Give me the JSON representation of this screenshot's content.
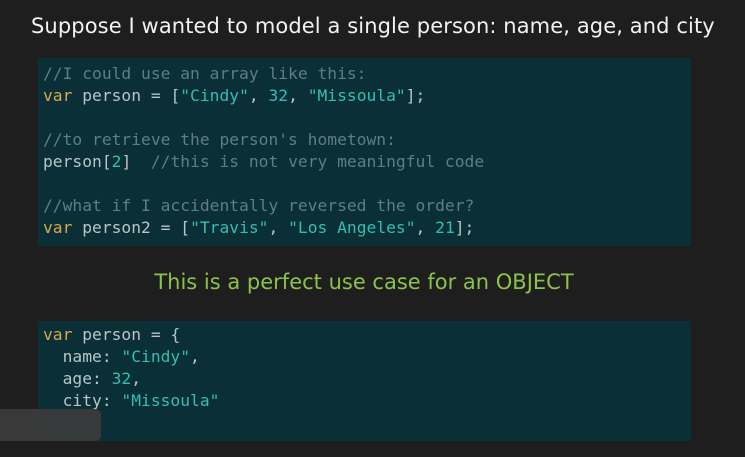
{
  "slide": {
    "title": "Suppose I wanted to model a single person: name, age, and city",
    "headline": "This is a perfect use case for an OBJECT"
  },
  "code_block_1": {
    "lines": [
      {
        "tokens": [
          {
            "type": "comment",
            "text": "//I could use an array like this:"
          }
        ]
      },
      {
        "tokens": [
          {
            "type": "keyword",
            "text": "var"
          },
          {
            "type": "plain",
            "text": " person = ["
          },
          {
            "type": "string",
            "text": "\"Cindy\""
          },
          {
            "type": "plain",
            "text": ", "
          },
          {
            "type": "number",
            "text": "32"
          },
          {
            "type": "plain",
            "text": ", "
          },
          {
            "type": "string",
            "text": "\"Missoula\""
          },
          {
            "type": "plain",
            "text": "];"
          }
        ]
      },
      {
        "tokens": []
      },
      {
        "tokens": [
          {
            "type": "comment",
            "text": "//to retrieve the person's hometown:"
          }
        ]
      },
      {
        "tokens": [
          {
            "type": "plain",
            "text": "person["
          },
          {
            "type": "number",
            "text": "2"
          },
          {
            "type": "plain",
            "text": "]  "
          },
          {
            "type": "comment",
            "text": "//this is not very meaningful code"
          }
        ]
      },
      {
        "tokens": []
      },
      {
        "tokens": [
          {
            "type": "comment",
            "text": "//what if I accidentally reversed the order?"
          }
        ]
      },
      {
        "tokens": [
          {
            "type": "keyword",
            "text": "var"
          },
          {
            "type": "plain",
            "text": " person2 = ["
          },
          {
            "type": "string",
            "text": "\"Travis\""
          },
          {
            "type": "plain",
            "text": ", "
          },
          {
            "type": "string",
            "text": "\"Los Angeles\""
          },
          {
            "type": "plain",
            "text": ", "
          },
          {
            "type": "number",
            "text": "21"
          },
          {
            "type": "plain",
            "text": "];"
          }
        ]
      }
    ]
  },
  "code_block_2": {
    "lines": [
      {
        "tokens": [
          {
            "type": "keyword",
            "text": "var"
          },
          {
            "type": "plain",
            "text": " person = {"
          }
        ]
      },
      {
        "tokens": [
          {
            "type": "plain",
            "text": "  name: "
          },
          {
            "type": "string",
            "text": "\"Cindy\""
          },
          {
            "type": "plain",
            "text": ","
          }
        ]
      },
      {
        "tokens": [
          {
            "type": "plain",
            "text": "  age: "
          },
          {
            "type": "number",
            "text": "32"
          },
          {
            "type": "plain",
            "text": ","
          }
        ]
      },
      {
        "tokens": [
          {
            "type": "plain",
            "text": "  city: "
          },
          {
            "type": "string",
            "text": "\"Missoula\""
          }
        ]
      }
    ]
  },
  "colors": {
    "background": "#1e1e1e",
    "code_background": "#0a2f36",
    "title": "#f2f2f2",
    "headline": "#8bc34a",
    "comment": "#5d7e86",
    "keyword": "#d6a94a",
    "plain": "#b8c5c8",
    "string": "#32bfb3"
  }
}
